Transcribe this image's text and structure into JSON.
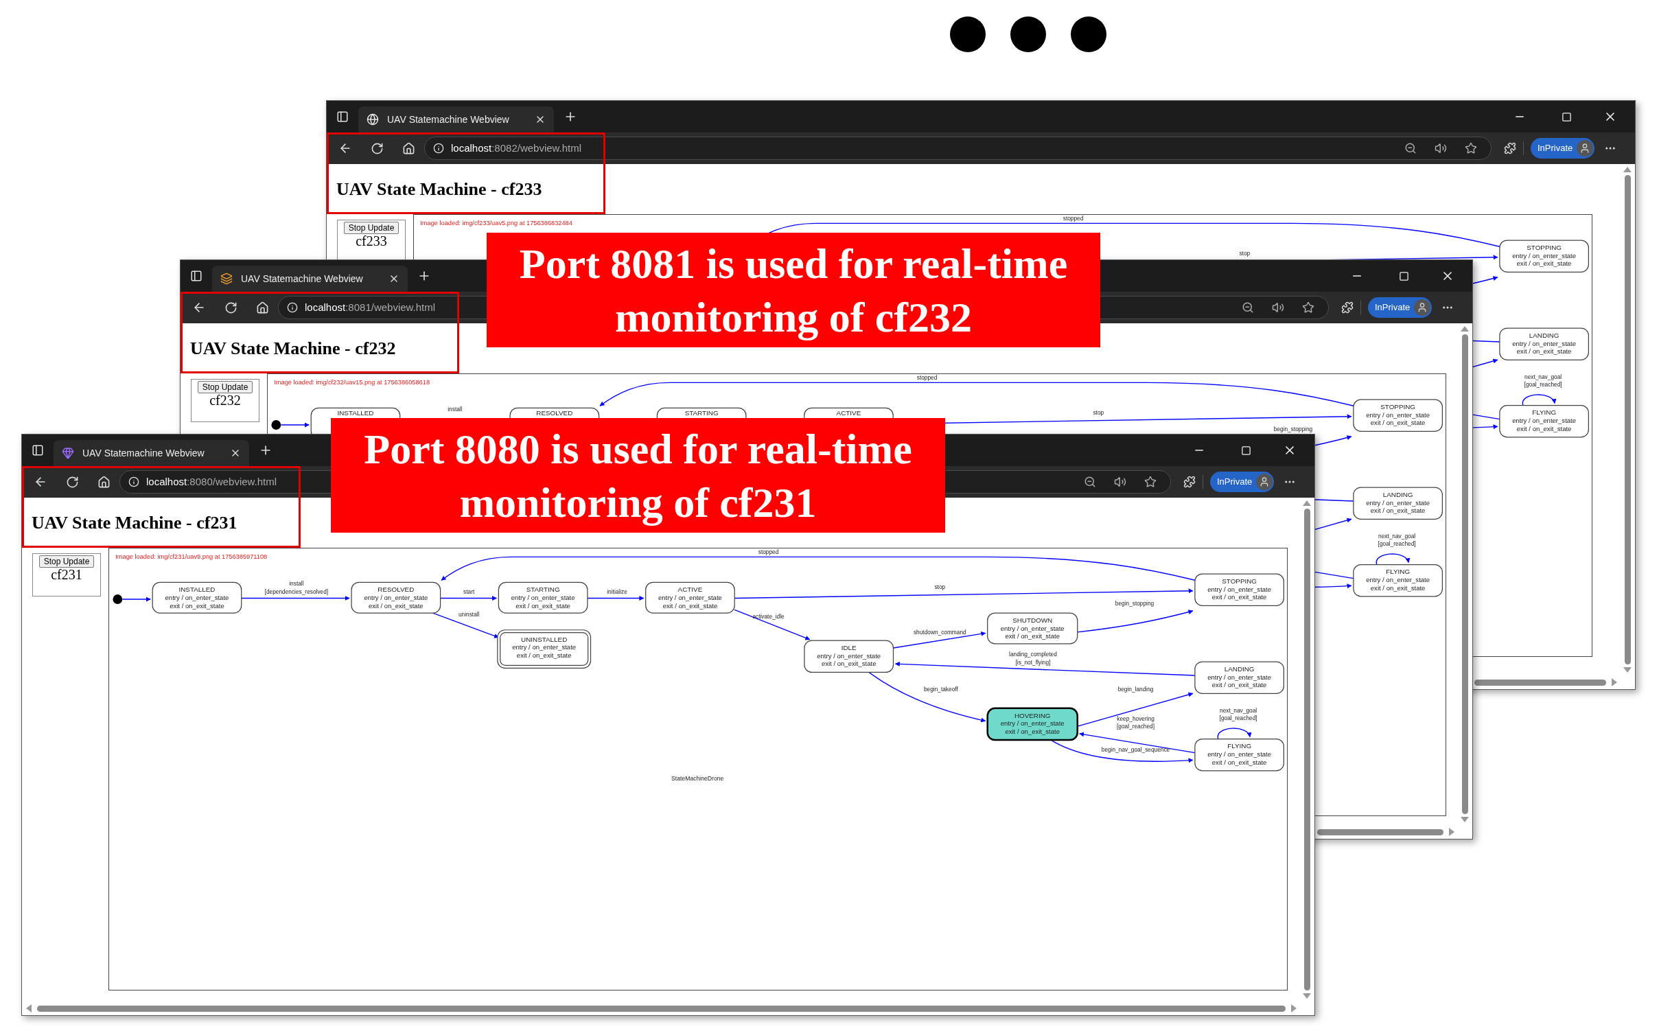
{
  "windows": [
    {
      "tab_title": "UAV Statemachine Webview",
      "url": {
        "host": "localhost",
        "path": ":8082/webview.html"
      },
      "profile": "InPrivate",
      "heading": "UAV State Machine - cf233",
      "stop_button": "Stop Update",
      "image_alt": "cf233",
      "status": "Image loaded: img/cf233/uav5.png at 1756386832484",
      "diagram": {
        "states": [
          {
            "kind": "state",
            "name": "STOPPING",
            "lines": [
              "entry / on_enter_state",
              "exit / on_exit_state"
            ],
            "current": false
          },
          {
            "kind": "state",
            "name": "LANDING",
            "lines": [
              "entry / on_enter_state",
              "exit / on_exit_state"
            ],
            "current": false
          },
          {
            "kind": "state",
            "name": "FLYING",
            "lines": [
              "entry / on_enter_state",
              "exit / on_exit_state"
            ],
            "current": false
          }
        ],
        "transitions": [
          {
            "lines": [
              "stopped"
            ]
          },
          {
            "lines": [
              "stop"
            ]
          },
          {
            "lines": [
              "next_nav_goal",
              "[goal_reached]"
            ]
          }
        ]
      }
    },
    {
      "tab_title": "UAV Statemachine Webview",
      "url": {
        "host": "localhost",
        "path": ":8081/webview.html"
      },
      "profile": "InPrivate",
      "heading": "UAV State Machine - cf232",
      "stop_button": "Stop Update",
      "image_alt": "cf232",
      "status": "Image loaded: img/cf232/uav15.png at 1756386058618",
      "diagram": {
        "states": [
          {
            "kind": "initial"
          },
          {
            "kind": "state",
            "name": "INSTALLED",
            "current": false
          },
          {
            "kind": "state",
            "name": "RESOLVED",
            "current": false
          },
          {
            "kind": "state",
            "name": "STARTING",
            "current": false
          },
          {
            "kind": "state",
            "name": "ACTIVE",
            "current": false
          },
          {
            "kind": "state",
            "name": "STOPPING",
            "lines": [
              "entry / on_enter_state",
              "exit / on_exit_state"
            ],
            "current": false
          },
          {
            "kind": "state",
            "name": "LANDING",
            "lines": [
              "entry / on_enter_state",
              "exit / on_exit_state"
            ],
            "current": false
          },
          {
            "kind": "state",
            "name": "FLYING",
            "lines": [
              "entry / on_enter_state",
              "exit / on_exit_state"
            ],
            "current": false
          }
        ],
        "transitions": [
          {
            "lines": [
              "stopped"
            ]
          },
          {
            "lines": [
              "install"
            ]
          },
          {
            "lines": [
              "stop"
            ]
          },
          {
            "lines": [
              "begin_stopping"
            ]
          },
          {
            "lines": [
              "next_nav_goal",
              "[goal_reached]"
            ]
          }
        ]
      }
    },
    {
      "tab_title": "UAV Statemachine Webview",
      "url": {
        "host": "localhost",
        "path": ":8080/webview.html"
      },
      "profile": "InPrivate",
      "heading": "UAV State Machine - cf231",
      "stop_button": "Stop Update",
      "image_alt": "cf231",
      "status": "Image loaded: img/cf231/uav9.png at 1756385971108",
      "diagram": {
        "title": "StateMachineDrone",
        "states": [
          {
            "kind": "initial"
          },
          {
            "kind": "state",
            "name": "INSTALLED",
            "lines": [
              "entry / on_enter_state",
              "exit / on_exit_state"
            ],
            "current": false
          },
          {
            "kind": "state",
            "name": "RESOLVED",
            "lines": [
              "entry / on_enter_state",
              "exit / on_exit_state"
            ],
            "current": false
          },
          {
            "kind": "state",
            "name": "STARTING",
            "lines": [
              "entry / on_enter_state",
              "exit / on_exit_state"
            ],
            "current": false
          },
          {
            "kind": "state",
            "name": "ACTIVE",
            "lines": [
              "entry / on_enter_state",
              "exit / on_exit_state"
            ],
            "current": false
          },
          {
            "kind": "final",
            "name": "UNINSTALLED",
            "lines": [
              "entry / on_enter_state",
              "exit / on_exit_state"
            ],
            "current": false
          },
          {
            "kind": "state",
            "name": "STOPPING",
            "lines": [
              "entry / on_enter_state",
              "exit / on_exit_state"
            ],
            "current": false
          },
          {
            "kind": "state",
            "name": "SHUTDOWN",
            "lines": [
              "entry / on_enter_state",
              "exit / on_exit_state"
            ],
            "current": false
          },
          {
            "kind": "state",
            "name": "IDLE",
            "lines": [
              "entry / on_enter_state",
              "exit / on_exit_state"
            ],
            "current": false
          },
          {
            "kind": "state",
            "name": "LANDING",
            "lines": [
              "entry / on_enter_state",
              "exit / on_exit_state"
            ],
            "current": false
          },
          {
            "kind": "state",
            "name": "HOVERING",
            "lines": [
              "entry / on_enter_state",
              "exit / on_exit_state"
            ],
            "current": true
          },
          {
            "kind": "state",
            "name": "FLYING",
            "lines": [
              "entry / on_enter_state",
              "exit / on_exit_state"
            ],
            "current": false
          }
        ],
        "transitions": [
          {
            "lines": [
              "install",
              "[dependencies_resolved]"
            ]
          },
          {
            "lines": [
              "start"
            ]
          },
          {
            "lines": [
              "initialize"
            ]
          },
          {
            "lines": [
              "uninstall"
            ]
          },
          {
            "lines": [
              "stop"
            ]
          },
          {
            "lines": [
              "stopped"
            ]
          },
          {
            "lines": [
              "activate_idle"
            ]
          },
          {
            "lines": [
              "shutdown_command"
            ]
          },
          {
            "lines": [
              "begin_stopping"
            ]
          },
          {
            "lines": [
              "landing_completed",
              "[is_not_flying]"
            ]
          },
          {
            "lines": [
              "begin_takeoff"
            ]
          },
          {
            "lines": [
              "begin_landing"
            ]
          },
          {
            "lines": [
              "keep_hovering",
              "[goal_reached]"
            ]
          },
          {
            "lines": [
              "begin_nav_goal_sequence"
            ]
          },
          {
            "lines": [
              "next_nav_goal",
              "[goal_reached]"
            ]
          }
        ]
      }
    }
  ],
  "callouts": [
    {
      "text": "Port 8081 is used for real-time monitoring of cf232"
    },
    {
      "text": "Port 8080 is used for real-time monitoring of cf231"
    }
  ]
}
